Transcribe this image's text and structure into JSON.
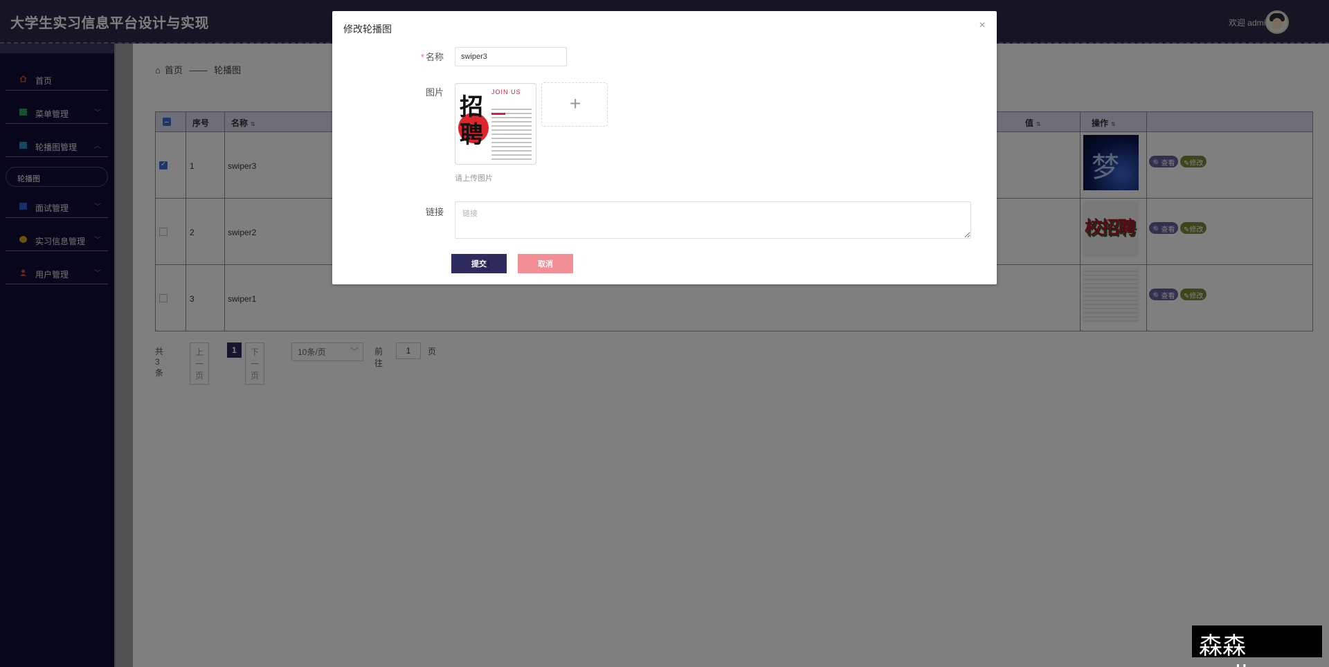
{
  "app": {
    "title": "大学生实习信息平台设计与实现",
    "welcome": "欢迎 admin"
  },
  "sidebar": {
    "items": [
      {
        "label": "首页",
        "icon": "home-icon",
        "color": "#e05a3a"
      },
      {
        "label": "菜单管理",
        "icon": "menu-icon",
        "color": "#2aa35a"
      },
      {
        "label": "轮播图管理",
        "icon": "image-icon",
        "color": "#2f86c9"
      },
      {
        "label": "面试管理",
        "icon": "interview-icon",
        "color": "#2f5fd8"
      },
      {
        "label": "实习信息管理",
        "icon": "info-icon",
        "color": "#d9a21a"
      },
      {
        "label": "用户管理",
        "icon": "user-icon",
        "color": "#e0424a"
      }
    ],
    "active_sub": "轮播图"
  },
  "breadcrumb": {
    "home": "首页",
    "sep": "——",
    "current": "轮播图"
  },
  "table": {
    "headers": {
      "index": "序号",
      "name": "名称",
      "value": "值",
      "action": "操作"
    },
    "rows": [
      {
        "index": "1",
        "name": "swiper3",
        "checked": true
      },
      {
        "index": "2",
        "name": "swiper2",
        "checked": false
      },
      {
        "index": "3",
        "name": "swiper1",
        "checked": false
      }
    ],
    "view_label": "查看",
    "edit_label": "修改"
  },
  "pager": {
    "total": "共 3 条",
    "prev": "上一页",
    "current": "1",
    "next": "下一页",
    "size": "10条/页",
    "goto": "前往",
    "goto_value": "1",
    "page_unit": "页"
  },
  "dialog": {
    "title": "修改轮播图",
    "close": "×",
    "name_label": "名称",
    "name_value": "swiper3",
    "image_label": "图片",
    "image_hint": "请上传图片",
    "preview": {
      "char1": "招",
      "char2": "聘",
      "join": "JOIN US"
    },
    "link_label": "链接",
    "link_placeholder": "链接",
    "submit": "提交",
    "cancel": "取消"
  },
  "watermark": "森森coding"
}
